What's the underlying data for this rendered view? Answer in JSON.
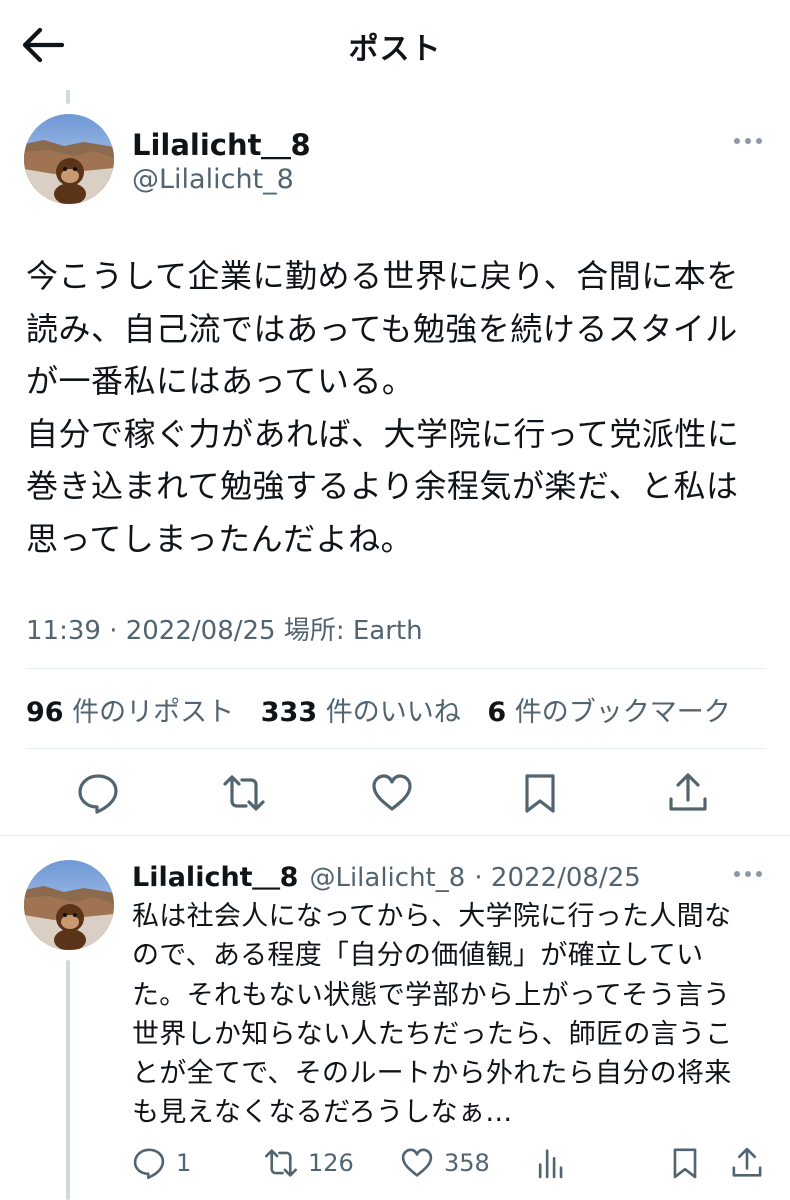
{
  "header": {
    "title": "ポスト",
    "back_icon": "arrow-left-icon"
  },
  "tweet": {
    "author_name": "Lilalicht＿8",
    "author_handle": "@Lilalicht_8",
    "text": "今こうして企業に勤める世界に戻り、合間に本を\n読み、自己流ではあっても勉強を続けるスタイル\nが一番私にはあっている。\n自分で稼ぐ力があれば、大学院に行って党派性に\n巻き込まれて勉強するより余程気が楽だ、と私は\n思ってしまったんだよね。",
    "timestamp": "11:39 · 2022/08/25 場所: Earth",
    "stats": {
      "reposts_count": "96",
      "reposts_label": "件のリポスト",
      "likes_count": "333",
      "likes_label": "件のいいね",
      "bookmarks_count": "6",
      "bookmarks_label": "件のブックマーク"
    },
    "actions": [
      "reply-icon",
      "repost-icon",
      "like-icon",
      "bookmark-icon",
      "share-icon"
    ]
  },
  "reply": {
    "author_name": "Lilalicht＿8",
    "author_handle": "@Lilalicht_8",
    "date": "· 2022/08/25",
    "text": "私は社会人になってから、大学院に行った人間な\nので、ある程度「自分の価値観」が確立してい\nた。それもない状態で学部から上がってそう言う\n世界しか知らない人たちだったら、師匠の言うこ\nとが全てで、そのルートから外れたら自分の将来\nも見えなくなるだろうしなぁ…",
    "replies": "1",
    "reposts": "126",
    "likes": "358"
  },
  "colors": {
    "text": "#0f1419",
    "secondary": "#536471",
    "divider": "#e6ecf0",
    "thread": "#cfd9de"
  }
}
